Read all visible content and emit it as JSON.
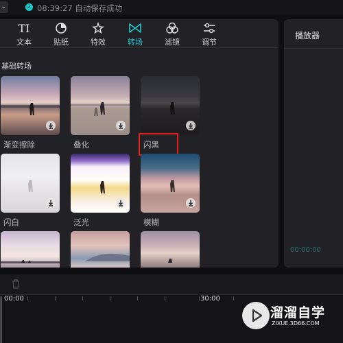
{
  "status_bar": {
    "save_status": "08:39:27 自动保存成功"
  },
  "tabs": [
    {
      "label": "文本",
      "icon": "text-icon"
    },
    {
      "label": "贴纸",
      "icon": "sticker-icon"
    },
    {
      "label": "特效",
      "icon": "effects-icon"
    },
    {
      "label": "转场",
      "icon": "transition-icon",
      "active": true
    },
    {
      "label": "滤镜",
      "icon": "filter-icon"
    },
    {
      "label": "调节",
      "icon": "adjust-icon"
    }
  ],
  "tab_text_glyph": "TI",
  "section_title": "基础转场",
  "transitions": [
    {
      "label": "渐变擦除"
    },
    {
      "label": "叠化"
    },
    {
      "label": "闪黑",
      "highlighted": true
    },
    {
      "label": "闪白"
    },
    {
      "label": "泛光"
    },
    {
      "label": "模糊"
    }
  ],
  "player": {
    "title": "播放器",
    "timecode": "00:00:00"
  },
  "timeline": {
    "ruler_labels": [
      "00:00",
      "30:00"
    ]
  },
  "watermark": {
    "name": "溜溜自学",
    "url": "ZIXUE.3D66.COM"
  },
  "colors": {
    "accent": "#22c8cf",
    "highlight_box": "#e3201b",
    "save_ok": "#1ec8c8"
  }
}
